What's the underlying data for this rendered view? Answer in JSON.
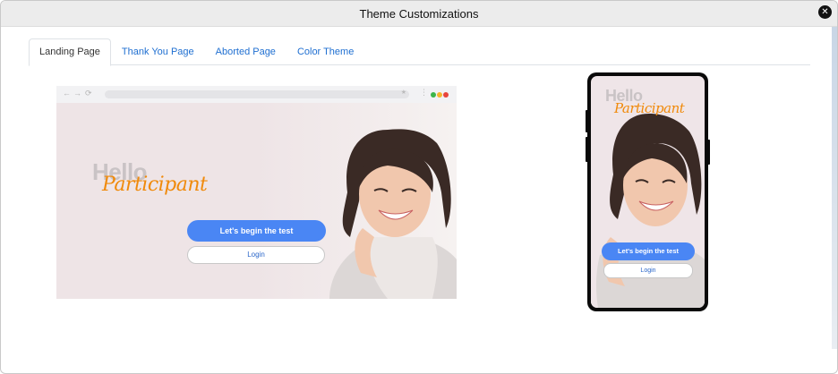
{
  "modal": {
    "title": "Theme Customizations",
    "close_symbol": "✕"
  },
  "tabs": [
    {
      "label": "Landing Page",
      "active": true
    },
    {
      "label": "Thank You Page",
      "active": false
    },
    {
      "label": "Aborted Page",
      "active": false
    },
    {
      "label": "Color Theme",
      "active": false
    }
  ],
  "preview": {
    "greeting": "Hello",
    "name": "Participant",
    "primary_button": "Let's begin the test",
    "secondary_button": "Login"
  },
  "browser_chrome": {
    "back_symbol": "←",
    "forward_symbol": "→",
    "reload_symbol": "⟳",
    "star_symbol": "★",
    "menu_symbol": "⋮",
    "window_dots": [
      "#3cb54a",
      "#f5b62b",
      "#e8453c"
    ]
  },
  "colors": {
    "accent": "#4a86f4",
    "name_text": "#f08a0b",
    "greeting_text": "#c9c3c5",
    "tab_link": "#1f6fd1",
    "background_pink": "#eee4e6"
  },
  "icons": {
    "close": "close-icon",
    "back": "back-arrow-icon",
    "forward": "forward-arrow-icon",
    "reload": "reload-icon",
    "star": "star-icon",
    "menu": "kebab-menu-icon"
  }
}
